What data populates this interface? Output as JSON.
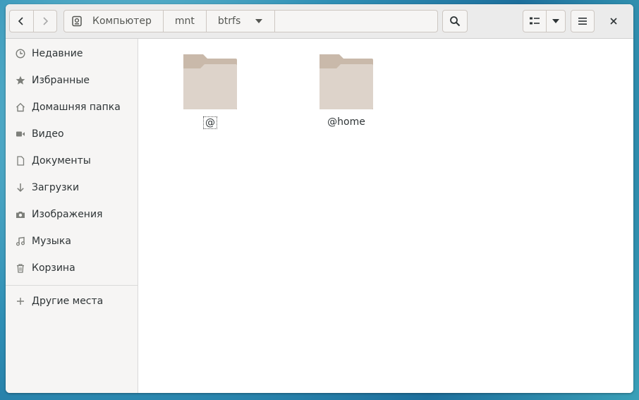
{
  "headerbar": {
    "path": [
      {
        "label": "Компьютер",
        "icon": "drive-icon"
      },
      {
        "label": "mnt"
      },
      {
        "label": "btrfs",
        "icon": "chevron-down-icon"
      }
    ]
  },
  "sidebar": {
    "items": [
      {
        "label": "Недавние",
        "icon": "clock-icon"
      },
      {
        "label": "Избранные",
        "icon": "star-icon"
      },
      {
        "label": "Домашняя папка",
        "icon": "home-icon"
      },
      {
        "label": "Видео",
        "icon": "video-icon"
      },
      {
        "label": "Документы",
        "icon": "document-icon"
      },
      {
        "label": "Загрузки",
        "icon": "download-icon"
      },
      {
        "label": "Изображения",
        "icon": "camera-icon"
      },
      {
        "label": "Музыка",
        "icon": "music-icon"
      },
      {
        "label": "Корзина",
        "icon": "trash-icon"
      }
    ],
    "other_places": {
      "label": "Другие места",
      "icon": "plus-icon"
    }
  },
  "files": [
    {
      "name": "@",
      "type": "folder",
      "focused": true
    },
    {
      "name": "@home",
      "type": "folder",
      "focused": false
    }
  ],
  "colors": {
    "folder_back": "#c9b9aa",
    "folder_front": "#ddd3ca",
    "headerbar_bg": "#ebebeb",
    "sidebar_bg": "#f6f5f4"
  }
}
